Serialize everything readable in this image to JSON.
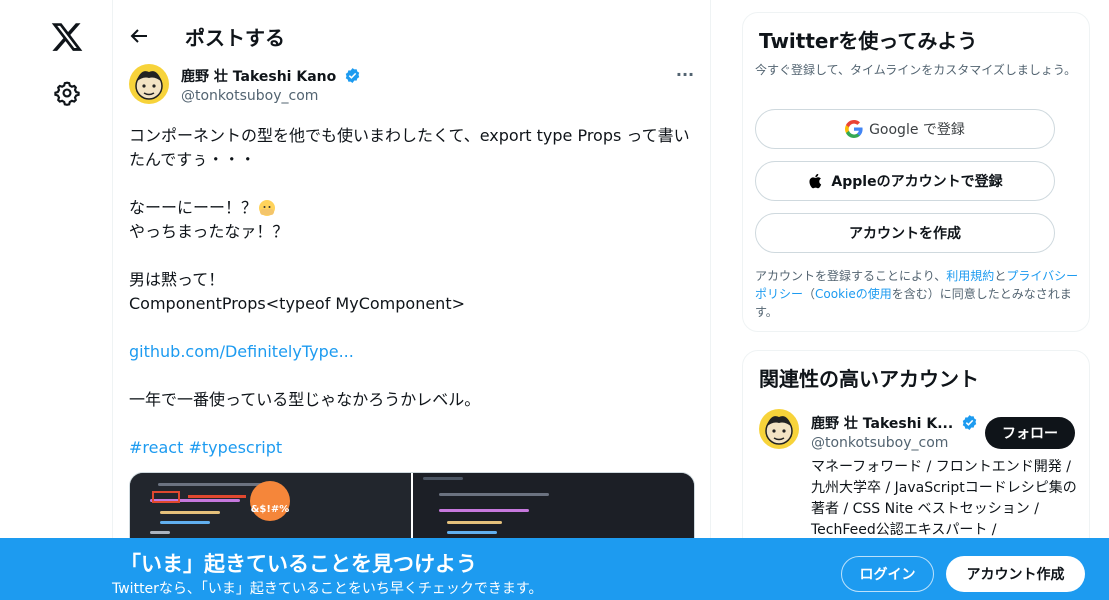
{
  "nav": {
    "logo_icon": "x-logo-icon",
    "settings_icon": "gear-icon"
  },
  "header": {
    "title": "ポストする"
  },
  "tweet": {
    "author_name": "鹿野 壮 Takeshi Kano",
    "author_handle": "@tonkotsuboy_com",
    "lines": [
      "コンポーネントの型を他でも使いまわしたくて、export type Props って書いたんですぅ・・・",
      "なーーにーー！？",
      "やっちまったなァ！？",
      "男は黙って！",
      "ComponentProps<typeof MyComponent>",
      "github.com/DefinitelyType...",
      "一年で一番使っている型じゃなかろうかレベル。",
      "#react #typescript"
    ],
    "media_overlay_text": "&$!#%"
  },
  "signup_card": {
    "title": "Twitterを使ってみよう",
    "subtitle": "今すぐ登録して、タイムラインをカスタマイズしましょう。",
    "google_label": "Google で登録",
    "apple_label": "Appleのアカウントで登録",
    "create_label": "アカウントを作成",
    "terms_prefix": "アカウントを登録することにより、",
    "terms_link1": "利用規約",
    "terms_and": "と",
    "terms_link2": "プライバシーポリシー",
    "terms_paren_open": "（",
    "terms_link3": "Cookieの使用",
    "terms_suffix": "を含む）に同意したとみなされます。"
  },
  "related": {
    "title": "関連性の高いアカウント",
    "name": "鹿野 壮 Takeshi K...",
    "handle": "@tonkotsuboy_com",
    "follow_label": "フォロー",
    "bio": "マネーフォワード / フロントエンド開発 / 九州大学卒 / JavaScriptコードレシピ集の著者 / CSS Nite ベストセッション / TechFeed公認エキスパート /"
  },
  "banner": {
    "title": "「いま」起きていることを見つけよう",
    "subtitle": "Twitterなら、「いま」起きていることをいち早くチェックできます。",
    "login_label": "ログイン",
    "signup_label": "アカウント作成"
  },
  "colors": {
    "accent": "#1d9bf0",
    "text": "#0f1419",
    "muted": "#536471"
  }
}
